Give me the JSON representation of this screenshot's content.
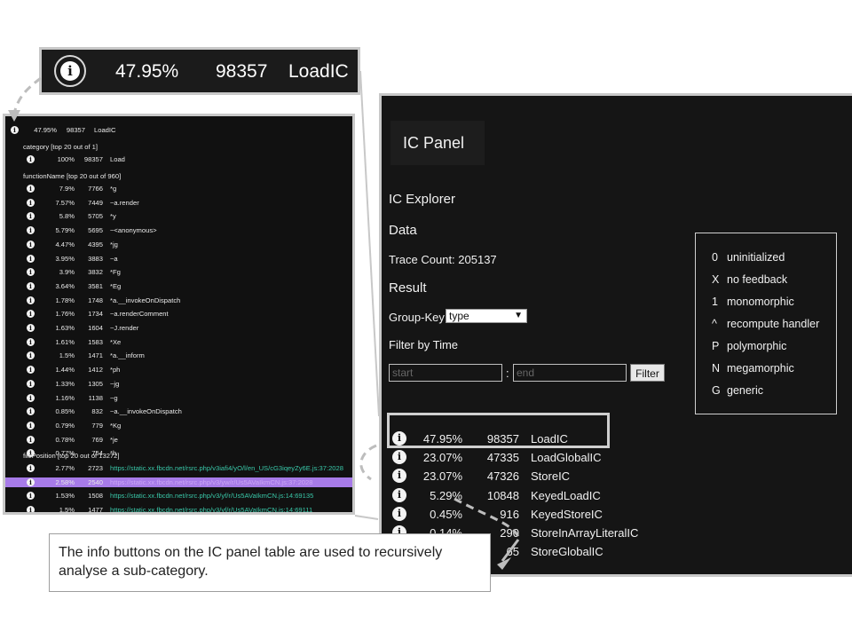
{
  "zoom": {
    "percent": "47.95%",
    "count": "98357",
    "name": "LoadIC"
  },
  "left": {
    "top_row": {
      "percent": "47.95%",
      "count": "98357",
      "name": "LoadIC"
    },
    "category_header": "category [top 20 out of 1]",
    "category_rows": [
      {
        "percent": "100%",
        "count": "98357",
        "name": "Load"
      }
    ],
    "function_header": "functionName [top 20 out of 960]",
    "function_rows": [
      {
        "percent": "7.9%",
        "count": "7766",
        "name": "*g"
      },
      {
        "percent": "7.57%",
        "count": "7449",
        "name": "~a.render"
      },
      {
        "percent": "5.8%",
        "count": "5705",
        "name": "*y"
      },
      {
        "percent": "5.79%",
        "count": "5695",
        "name": "~<anonymous>"
      },
      {
        "percent": "4.47%",
        "count": "4395",
        "name": "*jg"
      },
      {
        "percent": "3.95%",
        "count": "3883",
        "name": "~a"
      },
      {
        "percent": "3.9%",
        "count": "3832",
        "name": "*Fg"
      },
      {
        "percent": "3.64%",
        "count": "3581",
        "name": "*Eg"
      },
      {
        "percent": "1.78%",
        "count": "1748",
        "name": "*a.__invokeOnDispatch"
      },
      {
        "percent": "1.76%",
        "count": "1734",
        "name": "~a.renderComment"
      },
      {
        "percent": "1.63%",
        "count": "1604",
        "name": "~J.render"
      },
      {
        "percent": "1.61%",
        "count": "1583",
        "name": "*Xe"
      },
      {
        "percent": "1.5%",
        "count": "1471",
        "name": "*a.__inform"
      },
      {
        "percent": "1.44%",
        "count": "1412",
        "name": "*ph"
      },
      {
        "percent": "1.33%",
        "count": "1305",
        "name": "~jg"
      },
      {
        "percent": "1.16%",
        "count": "1138",
        "name": "~g"
      },
      {
        "percent": "0.85%",
        "count": "832",
        "name": "~a.__invokeOnDispatch"
      },
      {
        "percent": "0.79%",
        "count": "779",
        "name": "*Kg"
      },
      {
        "percent": "0.78%",
        "count": "769",
        "name": "*je"
      },
      {
        "percent": "0.77%",
        "count": "754",
        "name": "*h"
      }
    ],
    "file_header": "filePosition [top 20 out of 13272]",
    "file_rows": [
      {
        "percent": "2.77%",
        "count": "2723",
        "name": "https://static.xx.fbcdn.net/rsrc.php/v3iafi4/yO/l/en_US/cG3iqeyZy6E.js:37:2028"
      },
      {
        "percent": "2.58%",
        "count": "2540",
        "name": "https://static.xx.fbcdn.net/rsrc.php/v3/yw/r/Us5AVaIkmCN.js:37:2028"
      },
      {
        "percent": "1.53%",
        "count": "1508",
        "name": "https://static.xx.fbcdn.net/rsrc.php/v3/yf/r/Us5AVaIkmCN.js:14:69135"
      },
      {
        "percent": "1.5%",
        "count": "1477",
        "name": "https://static.xx.fbcdn.net/rsrc.php/v3/yf/r/Us5AVaIkmCN.js:14:69111"
      }
    ]
  },
  "right": {
    "panel_title": "IC Panel",
    "explorer_label": "IC Explorer",
    "data_label": "Data",
    "trace_count": "Trace Count: 205137",
    "result_label": "Result",
    "group_key_label": "Group-Key:",
    "group_key_value": "type",
    "filter_label": "Filter by Time",
    "start_placeholder": "start",
    "colon": ":",
    "end_placeholder": "end",
    "filter_button": "Filter",
    "legend": [
      {
        "key": "0",
        "label": "uninitialized"
      },
      {
        "key": "X",
        "label": "no feedback"
      },
      {
        "key": "1",
        "label": "monomorphic"
      },
      {
        "key": "^",
        "label": "recompute handler"
      },
      {
        "key": "P",
        "label": "polymorphic"
      },
      {
        "key": "N",
        "label": "megamorphic"
      },
      {
        "key": "G",
        "label": "generic"
      }
    ],
    "rows": [
      {
        "percent": "47.95%",
        "count": "98357",
        "name": "LoadIC"
      },
      {
        "percent": "23.07%",
        "count": "47335",
        "name": "LoadGlobalIC"
      },
      {
        "percent": "23.07%",
        "count": "47326",
        "name": "StoreIC"
      },
      {
        "percent": "5.29%",
        "count": "10848",
        "name": "KeyedLoadIC"
      },
      {
        "percent": "0.45%",
        "count": "916",
        "name": "KeyedStoreIC"
      },
      {
        "percent": "0.14%",
        "count": "290",
        "name": "StoreInArrayLiteralIC"
      },
      {
        "percent": "",
        "count": "65",
        "name": "StoreGlobalIC"
      }
    ]
  },
  "caption": "The info buttons on the IC panel table are used to recursively analyse a sub-category.",
  "colors": {
    "panel_bg": "#151515",
    "link": "#39c7a8",
    "selected_row": "#a77be8",
    "border": "#c8c8c8"
  }
}
